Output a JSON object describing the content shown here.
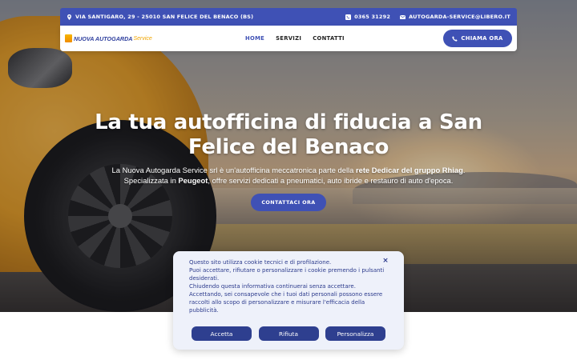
{
  "topbar": {
    "address": "VIA SANTIGARO, 29 - 25010 SAN FELICE DEL BENACO (BS)",
    "phone": "0365 31292",
    "email": "AUTOGARDA-SERVICE@LIBERO.IT"
  },
  "navbar": {
    "logo_text": "NUOVA AUTOGARDA",
    "logo_suffix": "Service",
    "links": [
      {
        "label": "HOME",
        "active": true
      },
      {
        "label": "SERVIZI",
        "active": false
      },
      {
        "label": "CONTATTI",
        "active": false
      }
    ],
    "call_label": "CHIAMA ORA"
  },
  "hero": {
    "title": "La tua autofficina di fiducia a San Felice del Benaco",
    "sub_line1_pre": "La Nuova Autogarda Service srl è un'autofficina meccatronica parte della ",
    "sub_line1_bold": "rete Dedicar del gruppo Rhiag",
    "sub_line1_post": ".",
    "sub_line2_pre": "Specializzata in ",
    "sub_line2_bold": "Peugeot",
    "sub_line2_post": ", offre servizi dedicati a pneumatici, auto ibride e restauro di auto d'epoca.",
    "cta_label": "CONTATTACI ORA"
  },
  "cookie": {
    "line1": "Questo sito utilizza cookie tecnici e di profilazione.",
    "line2": "Puoi accettare, rifiutare o personalizzare i cookie premendo i pulsanti desiderati.",
    "line3": "Chiudendo questa informativa continuerai senza accettare.",
    "line4": "Accettando, sei consapevole che i tuoi dati personali possono essere raccolti allo scopo di personalizzare e misurare l'efficacia della pubblicità.",
    "close": "×",
    "accept": "Accetta",
    "reject": "Rifiuta",
    "customize": "Personalizza"
  },
  "colors": {
    "brand": "#3f51b5",
    "cookie_button": "#2e3f8f",
    "cookie_bg": "#eef1fa"
  }
}
